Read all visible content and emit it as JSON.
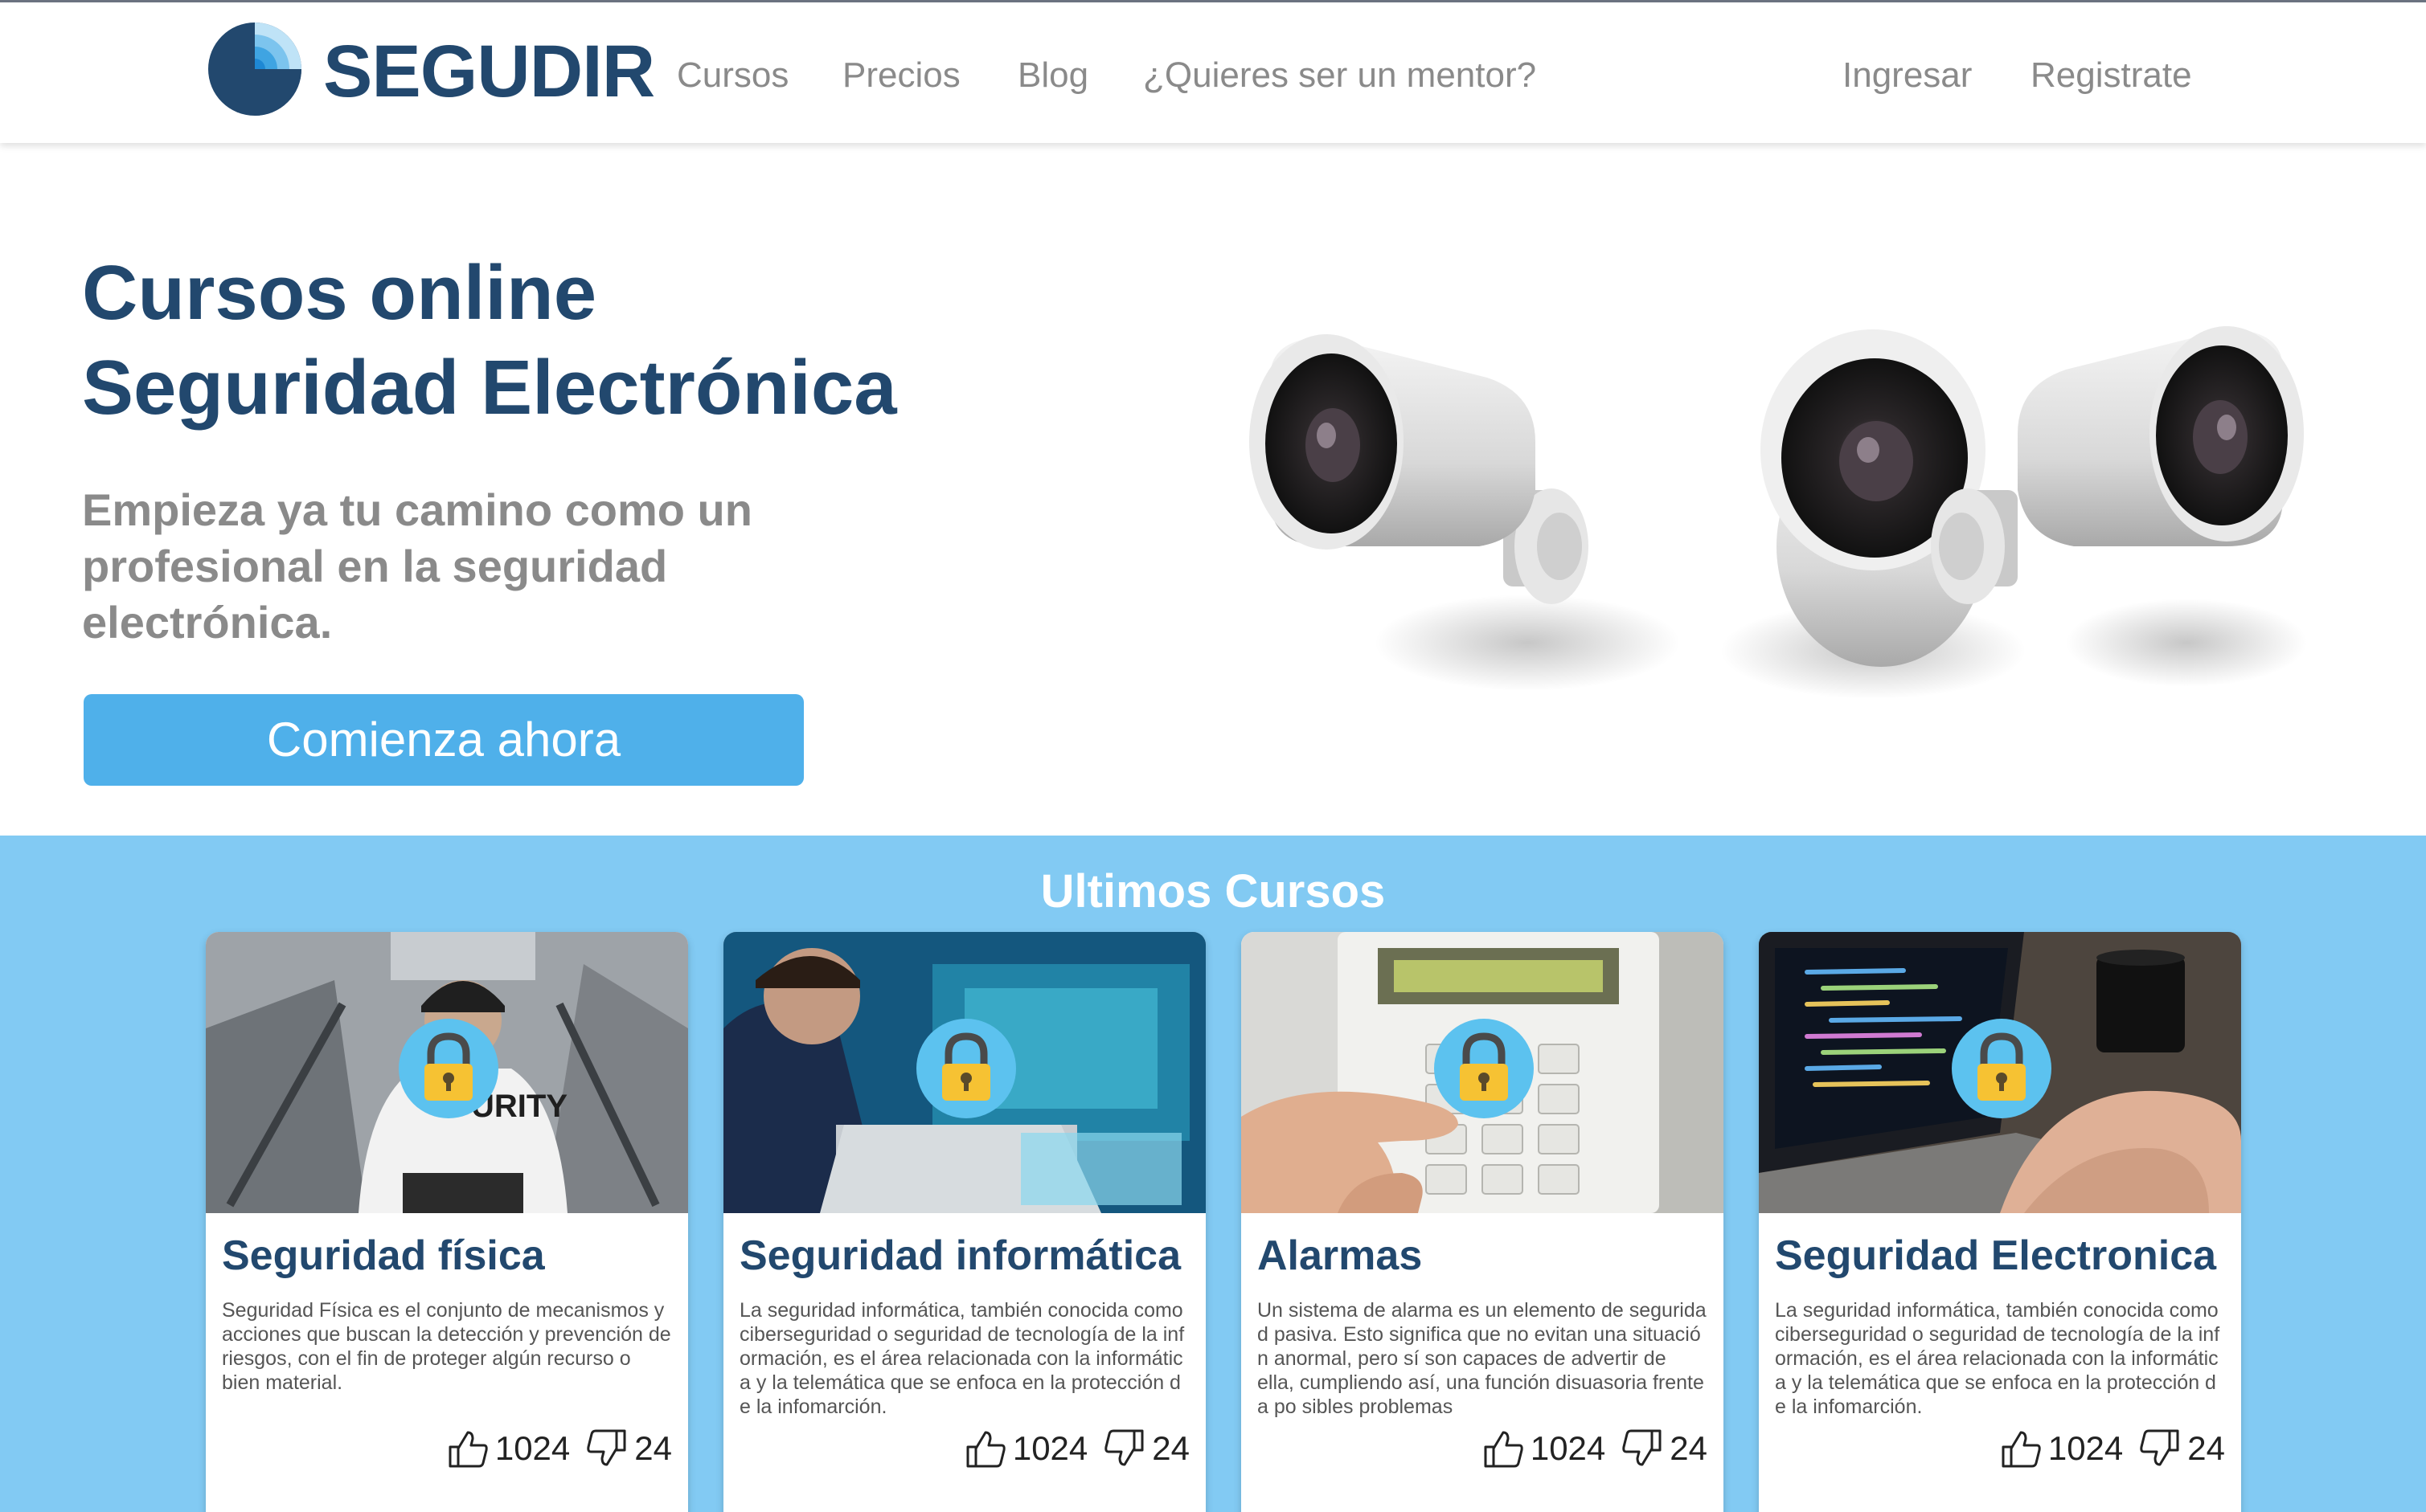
{
  "navbar": {
    "brand": "SEGUDIR",
    "links": [
      "Cursos",
      "Precios",
      "Blog",
      "¿Quieres ser un mentor?"
    ],
    "login": "Ingresar",
    "register": "Registrate"
  },
  "hero": {
    "title_line1": "Cursos online",
    "title_line2": "Seguridad Electrónica",
    "subtitle": "Empieza ya tu camino como un profesional en la seguridad electrónica.",
    "cta": "Comienza ahora"
  },
  "courses": {
    "section_title": "Ultimos Cursos",
    "items": [
      {
        "title": "Seguridad física",
        "description": "Seguridad Física es el conjunto de mecanismos y acciones que buscan la detección y prevención de riesgos, con el fin de proteger algún recurso o bien material.",
        "likes": "1024",
        "dislikes": "24"
      },
      {
        "title": "Seguridad informática",
        "description": "La seguridad informática, también conocida como ciberseguridad o seguridad de tecnología de la inf ormación,  es el área relacionada con la informátic a y la telemática que se enfoca en la protección d e la infomarción.",
        "likes": "1024",
        "dislikes": "24"
      },
      {
        "title": "Alarmas",
        "description": "Un sistema de alarma es un elemento de segurida d pasiva. Esto significa que no evitan una situació n anormal, pero sí son capaces de advertir de ella, cumpliendo así, una función disuasoria frente a po sibles problemas",
        "likes": "1024",
        "dislikes": "24"
      },
      {
        "title": "Seguridad Electronica",
        "description": "La seguridad informática, también conocida como ciberseguridad o seguridad de tecnología de la inf ormación,  es el área relacionada con la informátic a y la telemática que se enfoca en la protección d e la infomarción.",
        "likes": "1024",
        "dislikes": "24"
      }
    ]
  },
  "colors": {
    "brand_navy": "#22486e",
    "accent_blue": "#4fb0ea",
    "section_bg": "#82caf3",
    "nav_gray": "#8a8a8a"
  },
  "icons": [
    "logo-icon",
    "security-camera-icon",
    "lock-icon",
    "thumbs-up-icon",
    "thumbs-down-icon"
  ]
}
